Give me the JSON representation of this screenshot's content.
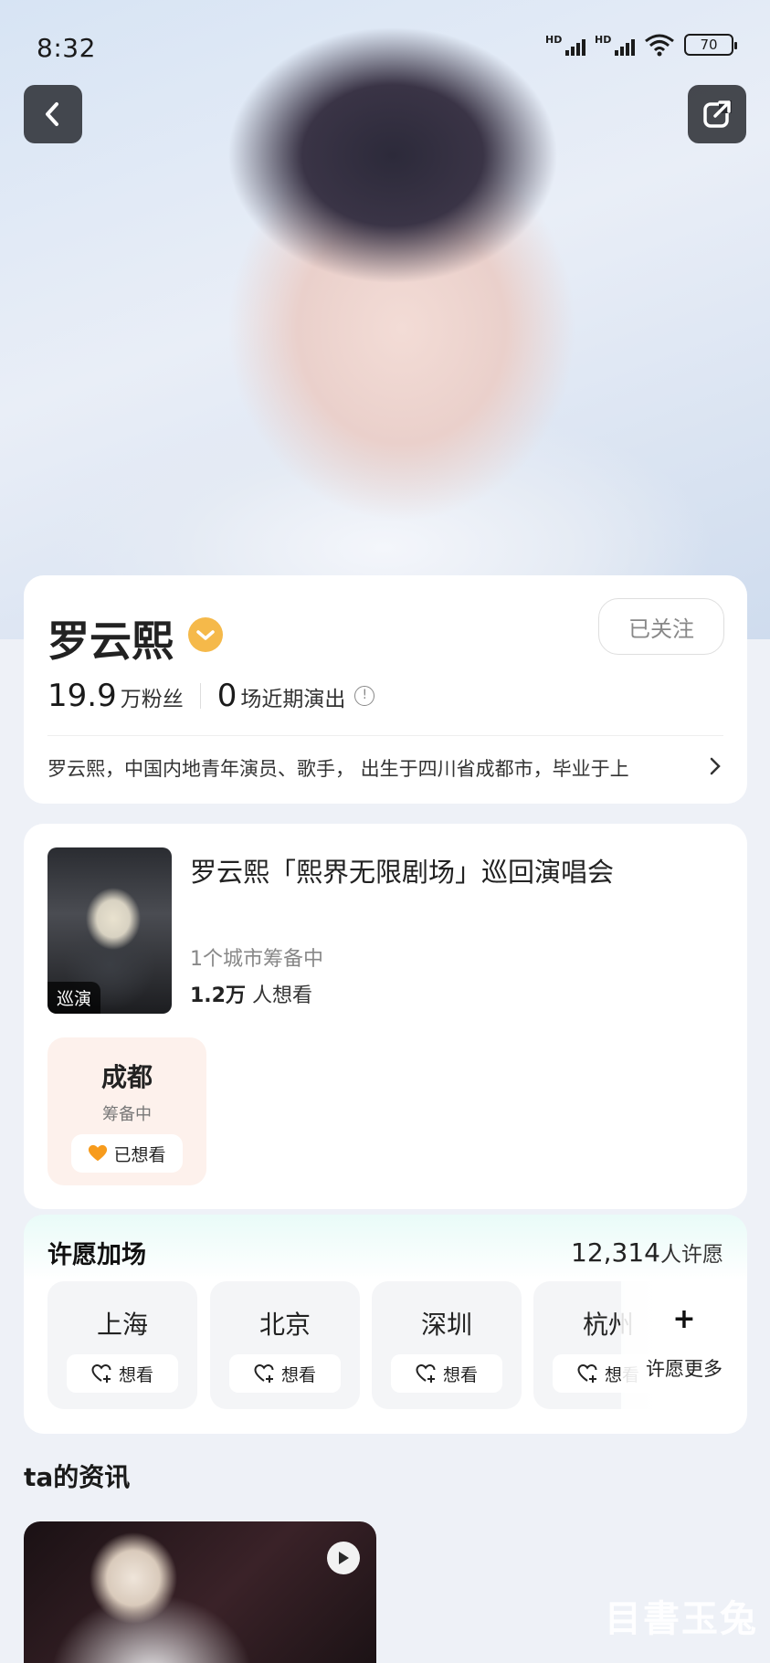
{
  "status_bar": {
    "time": "8:32",
    "hd1": "HD",
    "hd2": "HD",
    "battery": "70"
  },
  "header": {
    "back_icon": "back-arrow-icon",
    "share_icon": "share-icon"
  },
  "profile": {
    "name": "罗云熙",
    "follow_label": "已关注",
    "fans_count": "19.9",
    "fans_label": "万粉丝",
    "shows_count": "0",
    "shows_label": "场近期演出",
    "bio": "罗云熙，中国内地青年演员、歌手， 出生于四川省成都市，毕业于上",
    "verified_color": "#F5B94A"
  },
  "concert": {
    "poster_tag": "巡演",
    "title": "罗云熙「熙界无限剧场」巡回演唱会",
    "cities_status": "1个城市筹备中",
    "want_count": "1.2万",
    "want_label": "人想看",
    "city": {
      "name": "成都",
      "status": "筹备中",
      "wanted_label": "已想看"
    }
  },
  "wish": {
    "logo": "许愿加场",
    "count": "12,314",
    "count_label": "人许愿",
    "cities": [
      {
        "name": "上海",
        "want_label": "想看"
      },
      {
        "name": "北京",
        "want_label": "想看"
      },
      {
        "name": "深圳",
        "want_label": "想看"
      },
      {
        "name": "杭州",
        "want_label": "想看"
      }
    ],
    "more_label": "许愿更多",
    "more_plus": "+"
  },
  "news": {
    "title": "ta的资讯"
  },
  "watermark": "目書玉兔",
  "colors": {
    "accent": "#F5B94A",
    "background": "#EEF1F7",
    "tile_pink": "#FDF1EC"
  }
}
